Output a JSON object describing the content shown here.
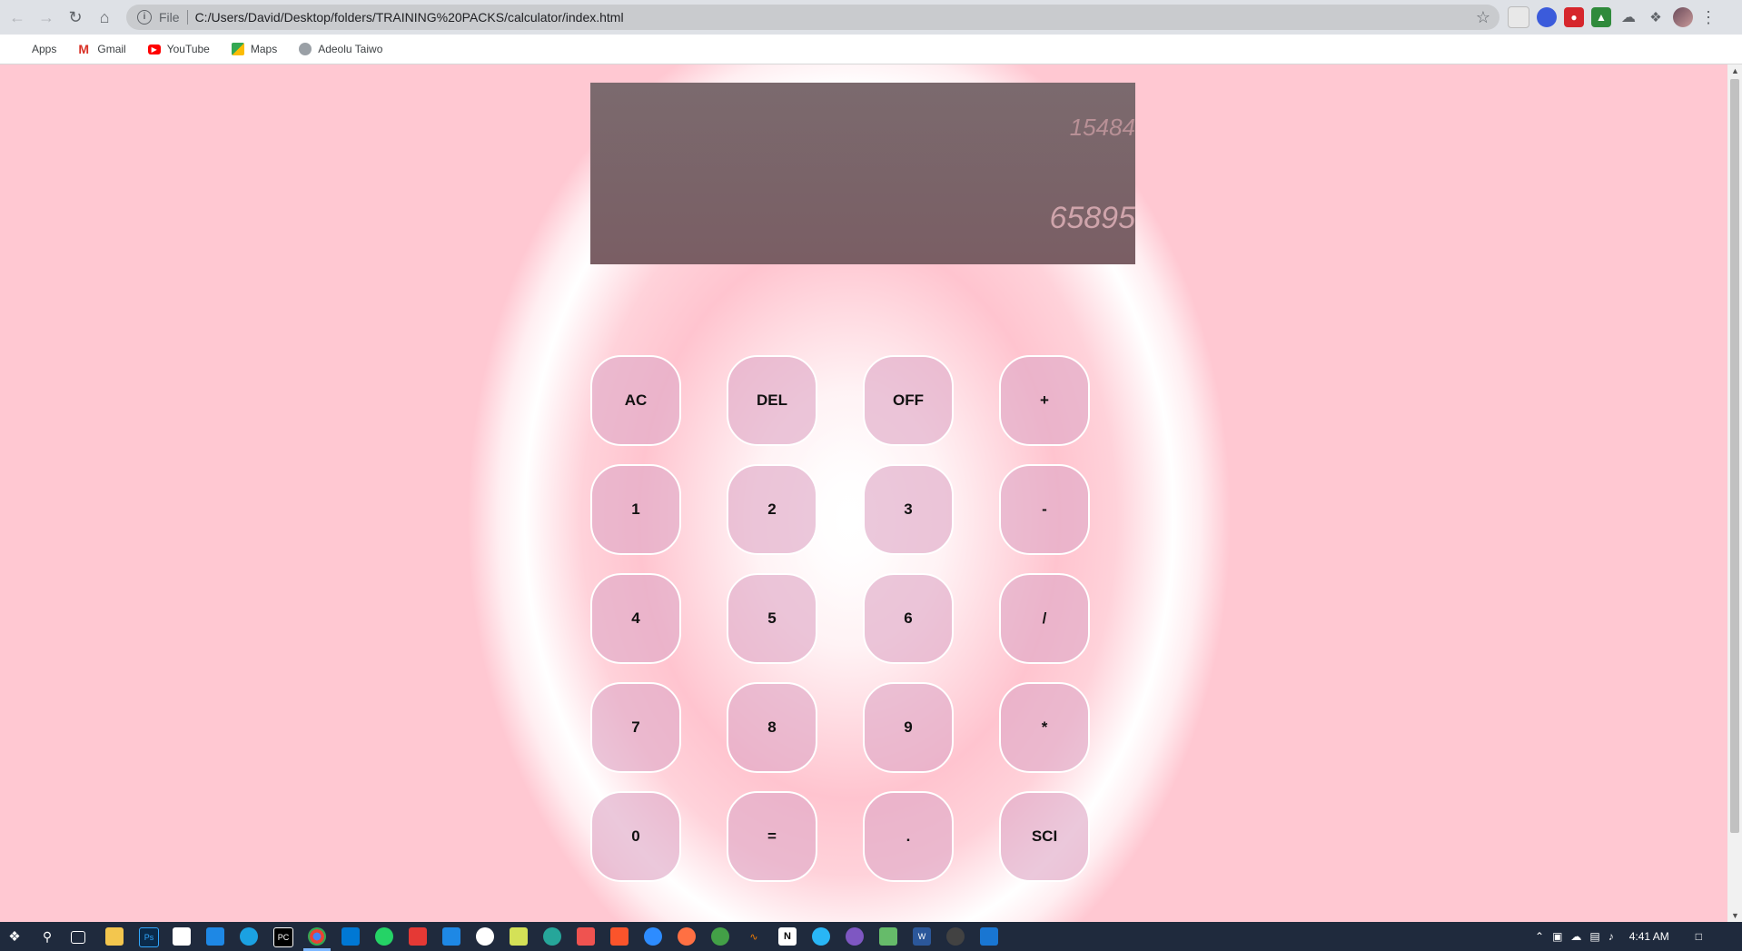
{
  "browser": {
    "address": {
      "scheme_label": "File",
      "url": "C:/Users/David/Desktop/folders/TRAINING%20PACKS/calculator/index.html"
    },
    "bookmarks": [
      {
        "label": "Apps",
        "icon": "apps-grid-icon"
      },
      {
        "label": "Gmail",
        "icon": "gmail-icon",
        "color": "#d93025"
      },
      {
        "label": "YouTube",
        "icon": "youtube-icon",
        "color": "#ff0000"
      },
      {
        "label": "Maps",
        "icon": "maps-icon",
        "color": "#34a853"
      },
      {
        "label": "Adeolu Taiwo",
        "icon": "globe-icon",
        "color": "#5f6368"
      }
    ]
  },
  "calculator": {
    "display": {
      "previous_operand": "15484",
      "current_operand": "65895"
    },
    "keys": [
      "AC",
      "DEL",
      "OFF",
      "+",
      "1",
      "2",
      "3",
      "-",
      "4",
      "5",
      "6",
      "/",
      "7",
      "8",
      "9",
      "*",
      "0",
      "=",
      ".",
      "SCI"
    ]
  },
  "taskbar": {
    "clock": "4:41 AM"
  },
  "colors": {
    "display_bg": "#7b6a6e",
    "key_bg": "#e3b1cc",
    "page_pink": "#ffc4cf",
    "taskbar_bg": "#1f2a3d"
  }
}
